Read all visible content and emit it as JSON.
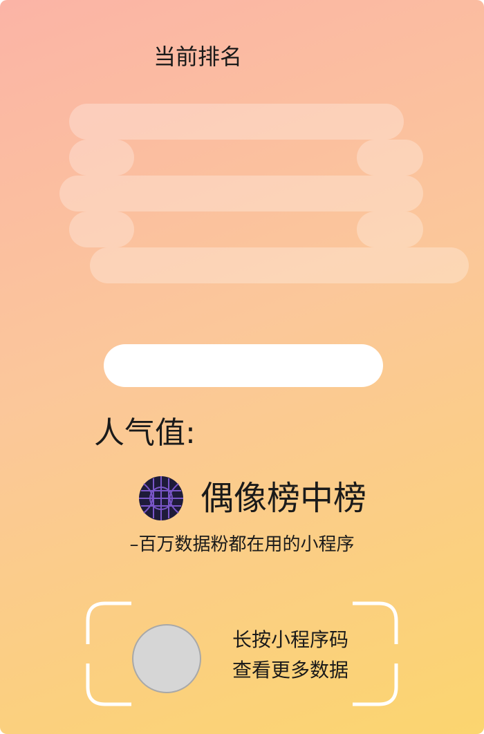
{
  "header": {
    "title": "当前排名"
  },
  "score": {
    "label": "人气值:"
  },
  "brand": {
    "logo_icon": "globe-grid-icon",
    "name": "偶像榜中榜",
    "tagline": "–百万数据粉都在用的小程序"
  },
  "qrcode": {
    "hint_line1": "长按小程序码",
    "hint_line2": "查看更多数据"
  },
  "colors": {
    "gradient_start": "#fbb4a6",
    "gradient_end": "#fbd56f",
    "logo_bg": "#1e1b3a",
    "logo_grid": "#7a56c8"
  }
}
